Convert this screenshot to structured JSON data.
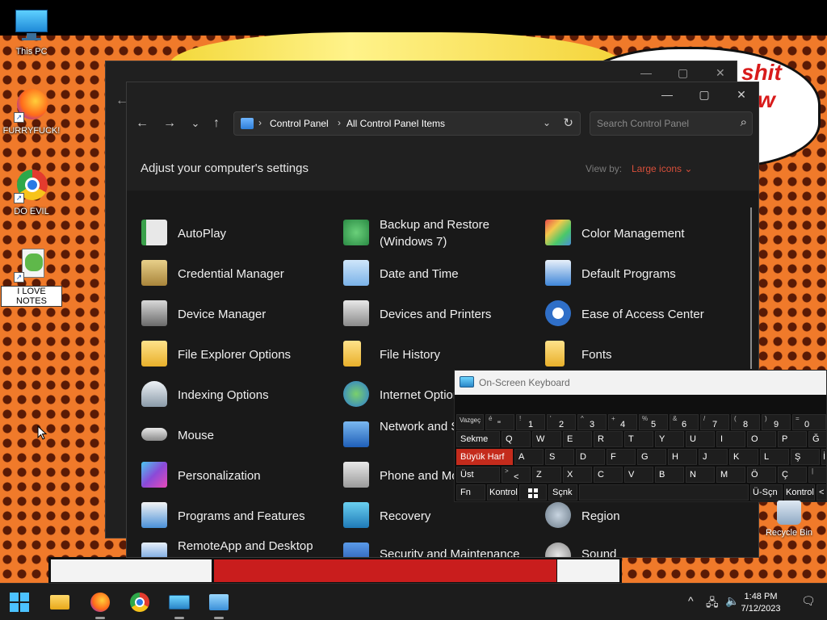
{
  "desktop": {
    "icons": [
      {
        "label": "This PC",
        "icon": "monitor-icon"
      },
      {
        "label": "FURRYFUCK!",
        "icon": "firefox-icon"
      },
      {
        "label": "DO EVIL",
        "icon": "chrome-icon"
      },
      {
        "label": "I LOVE NOTES",
        "icon": "notes-file-icon"
      }
    ],
    "recycle_bin": "Recycle Bin",
    "wallpaper_text": [
      "shit",
      "w"
    ]
  },
  "window": {
    "controls": {
      "minimize": "—",
      "maximize": "▢",
      "close": "✕"
    },
    "nav": {
      "back": "←",
      "forward": "→",
      "recent": "⌄",
      "up": "↑"
    },
    "breadcrumb": [
      "Control Panel",
      "All Control Panel Items"
    ],
    "search_placeholder": "Search Control Panel",
    "heading": "Adjust your computer's settings",
    "view_by_label": "View by:",
    "view_by_value": "Large icons",
    "items": [
      {
        "label": "AutoPlay",
        "icon": "autoplay-icon",
        "color": "#3aa04a"
      },
      {
        "label": "Backup and Restore (Windows 7)",
        "icon": "backup-icon",
        "color": "#2f9e57"
      },
      {
        "label": "Color Management",
        "icon": "color-management-icon",
        "color": "#4a8fd8"
      },
      {
        "label": "Credential Manager",
        "icon": "credential-icon",
        "color": "#c9a45a"
      },
      {
        "label": "Date and Time",
        "icon": "clock-icon",
        "color": "#9ec8f0"
      },
      {
        "label": "Default Programs",
        "icon": "default-programs-icon",
        "color": "#3f86d8"
      },
      {
        "label": "Device Manager",
        "icon": "device-manager-icon",
        "color": "#8a8a8a"
      },
      {
        "label": "Devices and Printers",
        "icon": "printer-icon",
        "color": "#9a9a9a"
      },
      {
        "label": "Ease of Access Center",
        "icon": "ease-of-access-icon",
        "color": "#2f6fc8"
      },
      {
        "label": "File Explorer Options",
        "icon": "folder-options-icon",
        "color": "#f2c94c"
      },
      {
        "label": "File History",
        "icon": "file-history-icon",
        "color": "#f2c94c"
      },
      {
        "label": "Fonts",
        "icon": "fonts-icon",
        "color": "#f2c94c"
      },
      {
        "label": "Indexing Options",
        "icon": "indexing-icon",
        "color": "#9aa8b8"
      },
      {
        "label": "Internet Options",
        "icon": "internet-icon",
        "color": "#3a8fd8"
      },
      {
        "label": "",
        "icon": "",
        "color": ""
      },
      {
        "label": "Mouse",
        "icon": "mouse-icon",
        "color": "#a0a0a0"
      },
      {
        "label": "Network and Sharing Center",
        "icon": "network-icon",
        "color": "#3a7fd0"
      },
      {
        "label": "",
        "icon": "",
        "color": ""
      },
      {
        "label": "Personalization",
        "icon": "personalization-icon",
        "color": "#6a5ad8"
      },
      {
        "label": "Phone and Modem",
        "icon": "phone-icon",
        "color": "#a0a0a0"
      },
      {
        "label": "",
        "icon": "",
        "color": ""
      },
      {
        "label": "Programs and Features",
        "icon": "programs-icon",
        "color": "#4a90d8"
      },
      {
        "label": "Recovery",
        "icon": "recovery-icon",
        "color": "#3aa0d8"
      },
      {
        "label": "Region",
        "icon": "region-icon",
        "color": "#8a9aa8"
      },
      {
        "label": "RemoteApp and Desktop",
        "icon": "remoteapp-icon",
        "color": "#3a7fd0"
      },
      {
        "label": "Security and Maintenance",
        "icon": "security-icon",
        "color": "#2f6fc8"
      },
      {
        "label": "Sound",
        "icon": "sound-icon",
        "color": "#b0b0b0"
      }
    ]
  },
  "osk": {
    "title": "On-Screen Keyboard",
    "row1": [
      {
        "top": "",
        "main": "Vazgeç"
      },
      {
        "top": "é",
        "main": "\""
      },
      {
        "top": "!",
        "main": "1"
      },
      {
        "top": "'",
        "main": "2"
      },
      {
        "top": "^",
        "main": "3"
      },
      {
        "top": "+",
        "main": "4"
      },
      {
        "top": "%",
        "main": "5"
      },
      {
        "top": "&",
        "main": "6"
      },
      {
        "top": "/",
        "main": "7"
      },
      {
        "top": "(",
        "main": "8"
      },
      {
        "top": ")",
        "main": "9"
      },
      {
        "top": "=",
        "main": "0"
      }
    ],
    "row2": [
      "Sekme",
      "Q",
      "W",
      "E",
      "R",
      "T",
      "Y",
      "U",
      "I",
      "O",
      "P",
      "Ğ"
    ],
    "row3": [
      "Büyük Harf",
      "A",
      "S",
      "D",
      "F",
      "G",
      "H",
      "J",
      "K",
      "L",
      "Ş",
      "İ"
    ],
    "row4": [
      "Üst",
      "<",
      "Z",
      "X",
      "C",
      "V",
      "B",
      "N",
      "M",
      "Ö",
      "Ç"
    ],
    "row4_top": [
      ">",
      "|"
    ],
    "row5": [
      "Fn",
      "Kontrol",
      "Sçnk",
      "Ü-Sçn",
      "Kontrol",
      "<"
    ]
  },
  "taskbar": {
    "apps": [
      "start-icon",
      "file-explorer-icon",
      "firefox-icon",
      "chrome-icon",
      "osk-icon",
      "control-panel-icon"
    ],
    "time": "1:48 PM",
    "date": "7/12/2023",
    "tray": [
      "^",
      "network-icon",
      "volume-icon",
      "notification-icon"
    ]
  }
}
